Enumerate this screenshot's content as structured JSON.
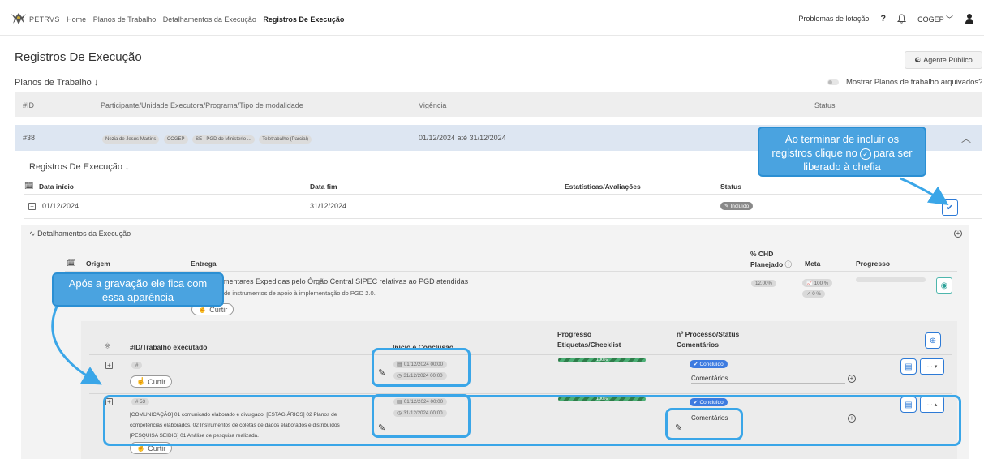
{
  "nav": {
    "brand": "PETRVS",
    "items": [
      "Home",
      "Planos de Trabalho",
      "Detalhamentos da Execução"
    ],
    "current": "Registros De Execução"
  },
  "topright": {
    "link": "Problemas de lotação",
    "help": "?",
    "user": "COGEP"
  },
  "page": {
    "title": "Registros De Execução",
    "agent_button": "Agente Público"
  },
  "plans": {
    "title": "Planos de Trabalho ↓",
    "toggle_label": "Mostrar Planos de trabalho arquivados?",
    "headers": {
      "id": "#ID",
      "participant": "Participante/Unidade Executora/Programa/Tipo de modalidade",
      "vigencia": "Vigência",
      "status": "Status"
    },
    "row": {
      "id": "#38",
      "chips": [
        "Nezia de Jesus Martins",
        "COGEP",
        "SE - PGD do Ministerio ...",
        "Teletrabalho (Parcial)"
      ],
      "vigencia": "01/12/2024 até 31/12/2024"
    }
  },
  "registros": {
    "title": "Registros De Execução ↓",
    "headers": {
      "inicio": "Data início",
      "fim": "Data fim",
      "estat": "Estatísticas/Avaliações",
      "status": "Status"
    },
    "row": {
      "inicio": "01/12/2024",
      "fim": "31/12/2024",
      "status": "Incluído"
    }
  },
  "detalhamentos": {
    "title": "Detalhamentos da Execução",
    "headers": {
      "origem": "Origem",
      "entrega": "Entrega",
      "chd_line1": "% CHD",
      "chd_line2": "Planejado",
      "meta": "Meta",
      "progresso": "Progresso"
    },
    "row": {
      "entrega_line1": "Complementares Expedidas pelo Órgão Central SIPEC relativas ao PGD atendidas",
      "entrega_line2": "de instrumentos de apoio à implementação do PGD 2.0.",
      "chd": "12.00%",
      "meta1": "100 %",
      "meta2": "0 %",
      "like": "Curtir"
    }
  },
  "trabalhos": {
    "headers": {
      "id": "#ID/Trabalho executado",
      "inicio": "Início e Conclusão",
      "prog_line1": "Progresso",
      "prog_line2": "Etiquetas/Checklist",
      "proc_line1": "nº Processo/Status",
      "proc_line2": "Comentários"
    },
    "rows": [
      {
        "id": "#",
        "text_lines": [],
        "start": "01/12/2024 00:00",
        "end": "31/12/2024 00:00",
        "progress_label": "100%",
        "progress": 1.0,
        "status": "Concluído",
        "comments": "Comentários",
        "like": "Curtir"
      },
      {
        "id": "# 53",
        "text_lines": [
          "[COMUNICAÇÃO] 01 comunicado elaborado e divulgado. [ESTAGIÁRIOS] 02 Planos de",
          "competências elaborados. 02 Instrumentos de coletas de dados elaborados e distribuídos",
          "[PESQUISA SEIDIG] 01 Análise de pesquisa realizada."
        ],
        "start": "01/12/2024 00:00",
        "end": "31/12/2024 00:00",
        "progress_label": "100%",
        "progress": 1.0,
        "status": "Concluído",
        "comments": "Comentários",
        "like": "Curtir"
      }
    ]
  },
  "callouts": {
    "right": [
      "Ao terminar de incluir os",
      "registros clique no",
      "para ser",
      "liberado à chefia"
    ],
    "left": [
      "Após a gravação ele fica com",
      "essa aparência"
    ]
  }
}
